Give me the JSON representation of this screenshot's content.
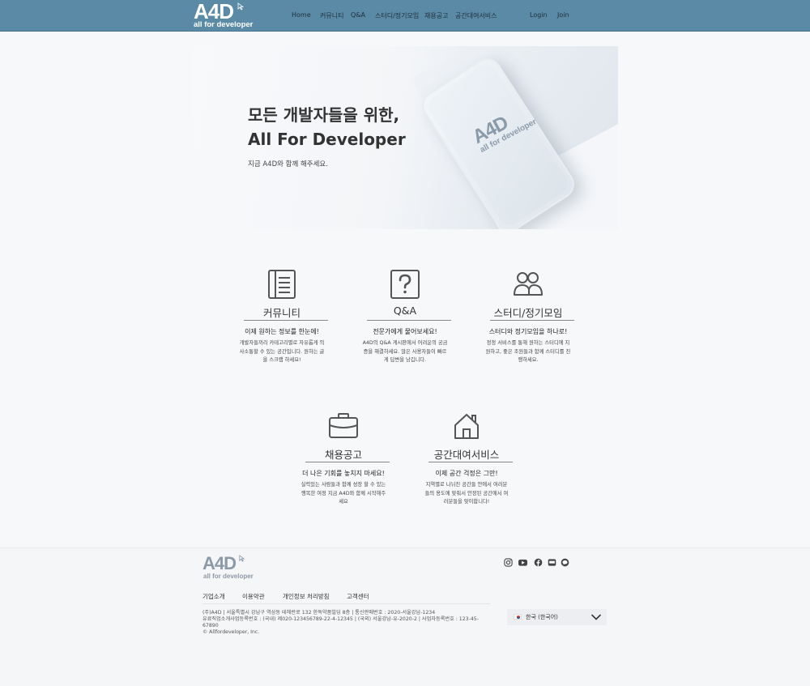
{
  "header": {
    "logo_mark": "A4D",
    "logo_sub": "all for developer",
    "nav": [
      "Home",
      "커뮤니티",
      "Q&A",
      "스터디/정기모임",
      "채용공고",
      "공간대여서비스"
    ],
    "login": "Login",
    "join": "Join"
  },
  "hero": {
    "title_line1": "모든 개발자들을 위한,",
    "title_line2": "All For Developer",
    "subtitle": "지금 A4D와 함께 해주세요.",
    "phone_logo_mark": "A4D",
    "phone_logo_sub": "all for developer"
  },
  "features": [
    {
      "icon": "community-icon",
      "title": "커뮤니티",
      "tagline": "이제 원하는 정보를 한눈에!",
      "desc": "개발자들끼리 카테고리별로 자유롭게 의사소통할 수 있는 공간입니다. 원하는 글을 스크랩 하세요!"
    },
    {
      "icon": "question-icon",
      "title": "Q&A",
      "tagline": "전문가에게 물어보세요!",
      "desc": "A4D의 Q&A 게시판에서 어려운의 궁금증을 해결하세요. 많은 사용자들이 빠르게 답변을 남깁니다."
    },
    {
      "icon": "people-icon",
      "title": "스터디/정기모임",
      "tagline": "스터디와 정기모임을 하나로!",
      "desc": "정정 서비스를 통해 원하는 스터디에 지원하고, 좋은 조원들과 함께 스터디를 진행하세요."
    },
    {
      "icon": "briefcase-icon",
      "title": "채용공고",
      "tagline": "더 나은 기회를 놓치지 마세요!",
      "desc": "실력있는 사람들과 함께 성장 할 수 있는 행복한 여정 지금 A4D와 함께 시작해주세요"
    },
    {
      "icon": "home-icon",
      "title": "공간대여서비스",
      "tagline": "이제 공간 걱정은 그만!",
      "desc": "지역별로 나뉘진 공간들 안에서 여러분들의 용도에 맞춰서 안정된 공간에서 여러분들을 맞이합니다!"
    }
  ],
  "footer": {
    "logo_mark": "A4D",
    "logo_sub": "all for developer",
    "links": [
      "기업소개",
      "이용약관",
      "개인정보 처리방침",
      "고객센터"
    ],
    "info_lines": [
      "(주)A4D | 서울특별시 강남구 역삼동 테헤란로 132 한독약품빌딩 8층 | 통신판매번호 : 2020-서울강남-1234",
      "유료직업소개사업등록번호 : (국내) 제020-123456789-22-4-12345 | (국외) 서울강남-유-2020-2 | 사업자등록번호 : 123-45-67890",
      "© Allfordeveloper, Inc."
    ],
    "language": "한국 (한국어)",
    "social": [
      "instagram-icon",
      "youtube-icon",
      "facebook-icon",
      "blog-icon",
      "kakao-icon"
    ]
  }
}
